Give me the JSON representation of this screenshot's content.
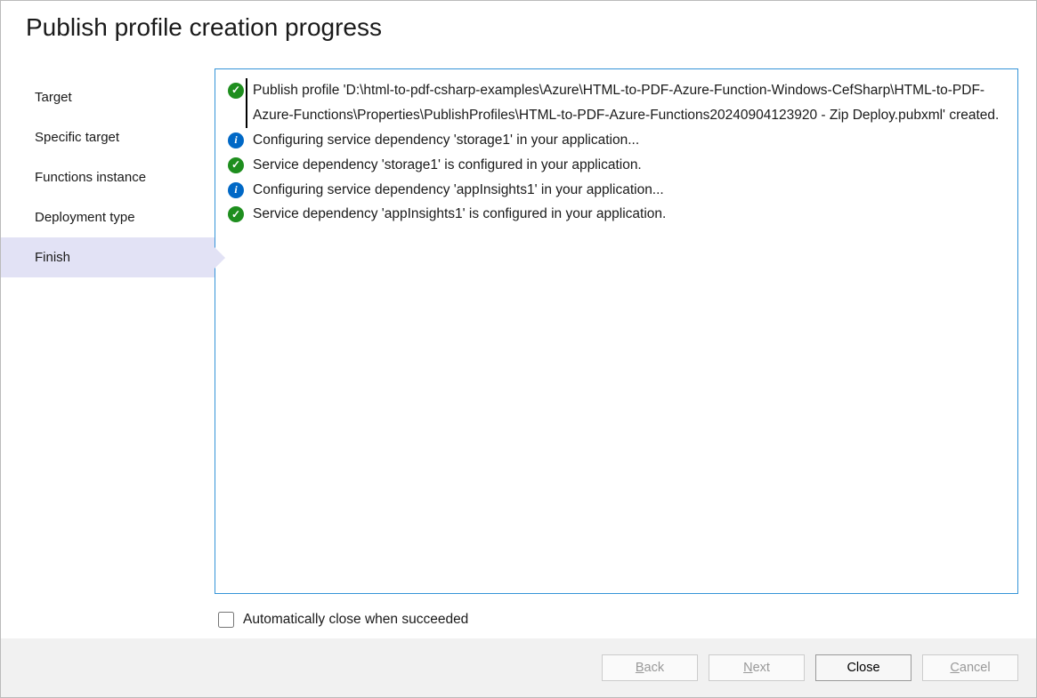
{
  "title": "Publish profile creation progress",
  "sidebar": {
    "items": [
      {
        "label": "Target",
        "active": false
      },
      {
        "label": "Specific target",
        "active": false
      },
      {
        "label": "Functions instance",
        "active": false
      },
      {
        "label": "Deployment type",
        "active": false
      },
      {
        "label": "Finish",
        "active": true
      }
    ]
  },
  "log": [
    {
      "status": "success",
      "text": " Publish profile 'D:\\html-to-pdf-csharp-examples\\Azure\\HTML-to-PDF-Azure-Function-Windows-CefSharp\\HTML-to-PDF-Azure-Functions\\Properties\\PublishProfiles\\HTML-to-PDF-Azure-Functions20240904123920 - Zip Deploy.pubxml' created."
    },
    {
      "status": "info",
      "text": "Configuring service dependency 'storage1' in your application..."
    },
    {
      "status": "success",
      "text": "Service dependency 'storage1' is configured in your application."
    },
    {
      "status": "info",
      "text": "Configuring service dependency 'appInsights1' in your application..."
    },
    {
      "status": "success",
      "text": "Service dependency 'appInsights1' is configured in your application."
    }
  ],
  "checkbox": {
    "label": "Automatically close when succeeded",
    "checked": false
  },
  "buttons": {
    "back": {
      "label": "Back",
      "hotkey": "B",
      "enabled": false
    },
    "next": {
      "label": "Next",
      "hotkey": "N",
      "enabled": false
    },
    "close": {
      "label": "Close",
      "hotkey": "",
      "enabled": true
    },
    "cancel": {
      "label": "Cancel",
      "hotkey": "C",
      "enabled": false
    }
  }
}
